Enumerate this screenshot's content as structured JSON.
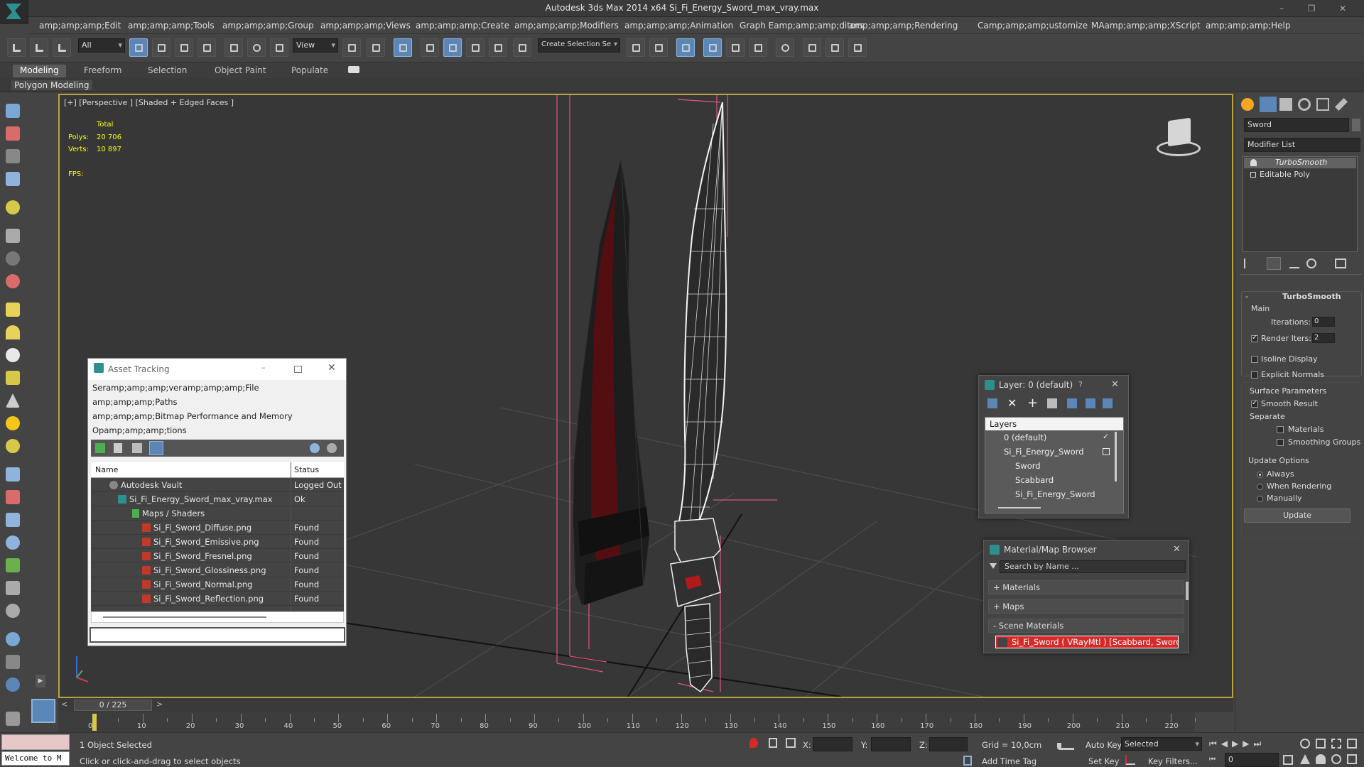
{
  "window": {
    "title": "Autodesk 3ds Max  2014 x64     Si_Fi_Energy_Sword_max_vray.max",
    "controls": [
      "–",
      "❐",
      "✕"
    ]
  },
  "menu": [
    "amp;amp;amp;Edit",
    "amp;amp;amp;Tools",
    "amp;amp;amp;Group",
    "amp;amp;amp;Views",
    "amp;amp;amp;Create",
    "amp;amp;amp;Modifiers",
    "amp;amp;amp;Animation",
    "Graph Eamp;amp;amp;ditors",
    "amp;amp;amp;Rendering",
    "Camp;amp;amp;ustomize",
    "MAamp;amp;amp;XScript",
    "amp;amp;amp;Help"
  ],
  "toolbar": {
    "filter_value": "All",
    "ref_coord_value": "View",
    "selection_set_placeholder": "Create Selection Se"
  },
  "ribbon": {
    "tabs": [
      "Modeling",
      "Freeform",
      "Selection",
      "Object Paint",
      "Populate"
    ],
    "panel_label": "Polygon Modeling"
  },
  "viewport": {
    "label": "[+] [Perspective ] [Shaded + Edged Faces ]",
    "stats": {
      "total_label": "Total",
      "polys_label": "Polys:",
      "polys_value": "20 706",
      "verts_label": "Verts:",
      "verts_value": "10 897",
      "fps_label": "FPS:"
    }
  },
  "command_panel": {
    "object_name": "Sword",
    "modifier_list_label": "Modifier List",
    "stack": [
      "TurboSmooth",
      "Editable Poly"
    ],
    "turbosmooth": {
      "title": "TurboSmooth",
      "main_label": "Main",
      "iterations_label": "Iterations:",
      "iterations_value": "0",
      "render_iters_label": "Render Iters:",
      "render_iters_value": "2",
      "render_iters_checked": true,
      "isoline_label": "Isoline Display",
      "explicit_normals_label": "Explicit Normals",
      "surface_params_label": "Surface Parameters",
      "smooth_result_label": "Smooth Result",
      "smooth_result_checked": true,
      "separate_label": "Separate",
      "materials_label": "Materials",
      "smoothing_groups_label": "Smoothing Groups",
      "update_options_label": "Update Options",
      "always_label": "Always",
      "when_rendering_label": "When Rendering",
      "manually_label": "Manually",
      "update_button": "Update"
    }
  },
  "asset_tracking": {
    "title": "Asset Tracking",
    "menu": [
      "Seramp;amp;amp;ver",
      "amp;amp;amp;File",
      "amp;amp;amp;Paths",
      "amp;amp;amp;Bitmap Performance and Memory",
      "Opamp;amp;amp;tions"
    ],
    "columns": [
      "Name",
      "Status"
    ],
    "rows": [
      {
        "name": "Autodesk Vault",
        "status": "Logged Out ..."
      },
      {
        "name": "Si_Fi_Energy_Sword_max_vray.max",
        "status": "Ok"
      },
      {
        "name": "Maps / Shaders",
        "status": ""
      },
      {
        "name": "Si_Fi_Sword_Diffuse.png",
        "status": "Found"
      },
      {
        "name": "Si_Fi_Sword_Emissive.png",
        "status": "Found"
      },
      {
        "name": "Si_Fi_Sword_Fresnel.png",
        "status": "Found"
      },
      {
        "name": "Si_Fi_Sword_Glossiness.png",
        "status": "Found"
      },
      {
        "name": "Si_Fi_Sword_Normal.png",
        "status": "Found"
      },
      {
        "name": "Si_Fi_Sword_Reflection.png",
        "status": "Found"
      }
    ]
  },
  "layer_dialog": {
    "title": "Layer: 0 (default)",
    "help": "?",
    "header": "Layers",
    "items": [
      "0 (default)",
      "Si_Fi_Energy_Sword",
      "Sword",
      "Scabbard",
      "Si_Fi_Energy_Sword"
    ]
  },
  "material_browser": {
    "title": "Material/Map Browser",
    "search_placeholder": "Search by Name ...",
    "groups": [
      "+ Materials",
      "+ Maps",
      "- Scene Materials"
    ],
    "scene_material": "Si_Fi_Sword  ( VRayMtl )  [Scabbard, Sword]"
  },
  "timeline": {
    "frame_readout": "0 / 225",
    "ticks": [
      "0",
      "10",
      "20",
      "30",
      "40",
      "50",
      "60",
      "70",
      "80",
      "90",
      "100",
      "110",
      "120",
      "130",
      "140",
      "150",
      "160",
      "170",
      "180",
      "190",
      "200",
      "210",
      "220"
    ]
  },
  "status": {
    "maxscript": "Welcome to M",
    "selection": "1 Object Selected",
    "prompt": "Click or click-and-drag to select objects",
    "x_label": "X:",
    "y_label": "Y:",
    "z_label": "Z:",
    "grid": "Grid = 10,0cm",
    "add_time_tag": "Add Time Tag",
    "auto_key": "Auto Key",
    "set_key": "Set Key",
    "selected_value": "Selected",
    "key_filters": "Key Filters...",
    "frame_value": "0"
  },
  "colors": {
    "viewport_border": "#b9a33c",
    "accent": "#5a87b8",
    "status_red": "#d42a2a"
  }
}
